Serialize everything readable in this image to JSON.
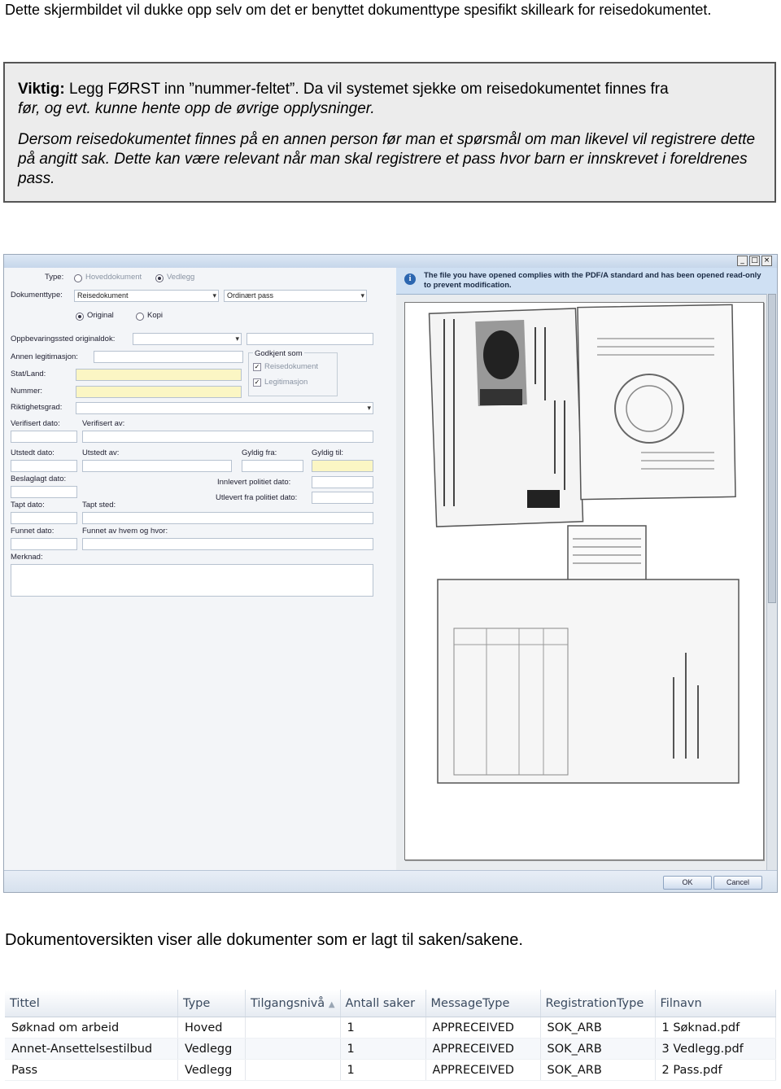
{
  "intro_text": "Dette skjermbildet vil dukke opp selv om det er benyttet dokumenttype spesifikt skilleark for reisedokumentet.",
  "callout": {
    "p1_bold": "Viktig:",
    "p1_rest": " Legg FØRST inn ”nummer-feltet”. Da vil systemet sjekke om reisedokumentet finnes fra",
    "p1_line2": "før, og evt. kunne hente opp de øvrige opplysninger.",
    "p2": "Dersom reisedokumentet finnes på en annen person før man et spørsmål om man likevel vil registrere dette på angitt sak. Dette kan være relevant når man skal registrere et pass hvor barn er innskrevet i foreldrenes pass."
  },
  "screenshot": {
    "window_buttons": [
      "_",
      "□",
      "×"
    ],
    "form": {
      "type_label": "Type:",
      "type_options": [
        "Hoveddokument",
        "Vedlegg"
      ],
      "type_selected": 1,
      "doktype_label": "Dokumenttype:",
      "doktype_value": "Reisedokument",
      "doktype_sub_value": "Ordinært pass",
      "original_options": [
        "Original",
        "Kopi"
      ],
      "original_selected": 0,
      "oppbevaring_label": "Oppbevaringssted originaldok:",
      "annen_legit_label": "Annen legitimasjon:",
      "godkjent_title": "Godkjent som",
      "godkjent_items": [
        "Reisedokument",
        "Legitimasjon"
      ],
      "stat_label": "Stat/Land:",
      "nummer_label": "Nummer:",
      "riktighet_label": "Riktighetsgrad:",
      "verifisert_dato_label": "Verifisert dato:",
      "verifisert_av_label": "Verifisert av:",
      "utstedt_dato_label": "Utstedt dato:",
      "utstedt_av_label": "Utstedt av:",
      "gyldig_fra_label": "Gyldig fra:",
      "gyldig_til_label": "Gyldig til:",
      "beslaglagt_label": "Beslaglagt dato:",
      "innlevert_label": "Innlevert politiet dato:",
      "utlevert_label": "Utlevert fra politiet dato:",
      "tapt_dato_label": "Tapt dato:",
      "tapt_sted_label": "Tapt sted:",
      "funnet_dato_label": "Funnet dato:",
      "funnet_av_label": "Funnet av hvem og hvor:",
      "merknad_label": "Merknad:"
    },
    "pdf_message": "The file you have opened complies with the PDF/A standard and has been opened read-only to prevent modification.",
    "ok_label": "OK",
    "cancel_label": "Cancel"
  },
  "caption2": "Dokumentoversikten viser alle dokumenter som er lagt til saken/sakene.",
  "table": {
    "columns": [
      "Tittel",
      "Type",
      "Tilgangsnivå",
      "Antall saker",
      "MessageType",
      "RegistrationType",
      "Filnavn"
    ],
    "rows": [
      [
        "Søknad om arbeid",
        "Hoved",
        "",
        "1",
        "APPRECEIVED",
        "SOK_ARB",
        "1 Søknad.pdf"
      ],
      [
        "Annet-Ansettelsestilbud",
        "Vedlegg",
        "",
        "1",
        "APPRECEIVED",
        "SOK_ARB",
        "3 Vedlegg.pdf"
      ],
      [
        "Pass",
        "Vedlegg",
        "",
        "1",
        "APPRECEIVED",
        "SOK_ARB",
        "2 Pass.pdf"
      ]
    ]
  }
}
